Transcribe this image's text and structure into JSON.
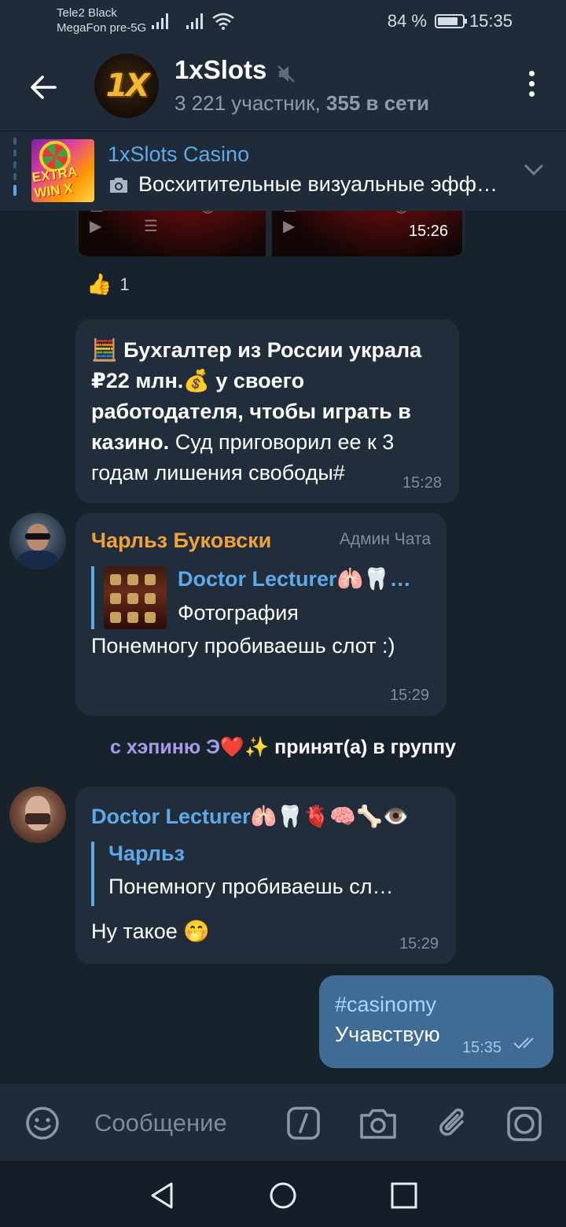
{
  "status": {
    "carrier1": "Tele2 Black",
    "carrier2": "MegaFon pre-5G",
    "battery": "84 %",
    "battery_level": 0.84,
    "time": "15:35"
  },
  "header": {
    "title": "1xSlots",
    "members": "3 221 участник, ",
    "online": "355 в сети",
    "avatar_logo": "1X"
  },
  "pinned": {
    "title": "1xSlots Casino",
    "text": "Восхитительные визуальные эффекты",
    "thumb_text": "EXTRA WIN X"
  },
  "album": {
    "time": "15:26"
  },
  "reaction": {
    "emoji": "👍",
    "count": "1"
  },
  "msg1": {
    "emoji1": "🧮",
    "bold1": "Бухгалтер из России украла ₽22 млн.",
    "emoji2": "💰",
    "bold2": " у своего работодателя, чтобы играть в казино.",
    "rest": " Суд приговорил ее к 3 годам лишения свободы#",
    "time": "15:28"
  },
  "msg2": {
    "sender": "Чарльз Буковски",
    "admin": "Админ Чата",
    "reply_name": "Doctor Lecturer🫁🦷…",
    "reply_text": "Фотография",
    "text": "Понемногу пробиваешь слот :)",
    "time": "15:29"
  },
  "service": {
    "who": "с хэпиню Э❤️✨",
    "action": " принят(а) в группу"
  },
  "msg3": {
    "sender": "Doctor Lecturer🫁🦷🫀🧠🦴👁️",
    "reply_name": "Чарльз",
    "reply_text": "Понемногу пробиваешь сл…",
    "text": "Ну такое 🤭",
    "time": "15:29"
  },
  "msg4": {
    "tag": "#casinomy",
    "text": "Учавствую",
    "time": "15:35"
  },
  "input": {
    "placeholder": "Сообщение"
  },
  "colors": {
    "background": "#18222d",
    "bar": "#1f2b38",
    "incoming": "#212d3b",
    "outgoing": "#3f6b95",
    "link": "#5ea9e8",
    "admin_name": "#f0a33b"
  }
}
